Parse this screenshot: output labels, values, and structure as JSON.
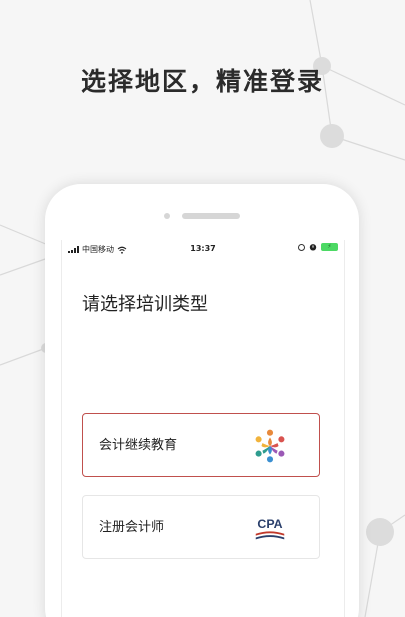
{
  "headline": "选择地区，精准登录",
  "status_bar": {
    "carrier": "中国移动",
    "time": "13:37",
    "signal_icon": "signal-bars-icon",
    "wifi_icon": "wifi-icon",
    "battery_icon": "battery-charging-icon"
  },
  "screen": {
    "title": "请选择培训类型",
    "options": [
      {
        "label": "会计继续教育",
        "logo": "people-circle-logo",
        "selected": true
      },
      {
        "label": "注册会计师",
        "logo_text": "CPA",
        "logo": "cpa-logo",
        "selected": false
      }
    ]
  },
  "colors": {
    "background": "#f6f6f6",
    "selected_border": "#c0504d",
    "headline_text": "#2b2b2b"
  }
}
